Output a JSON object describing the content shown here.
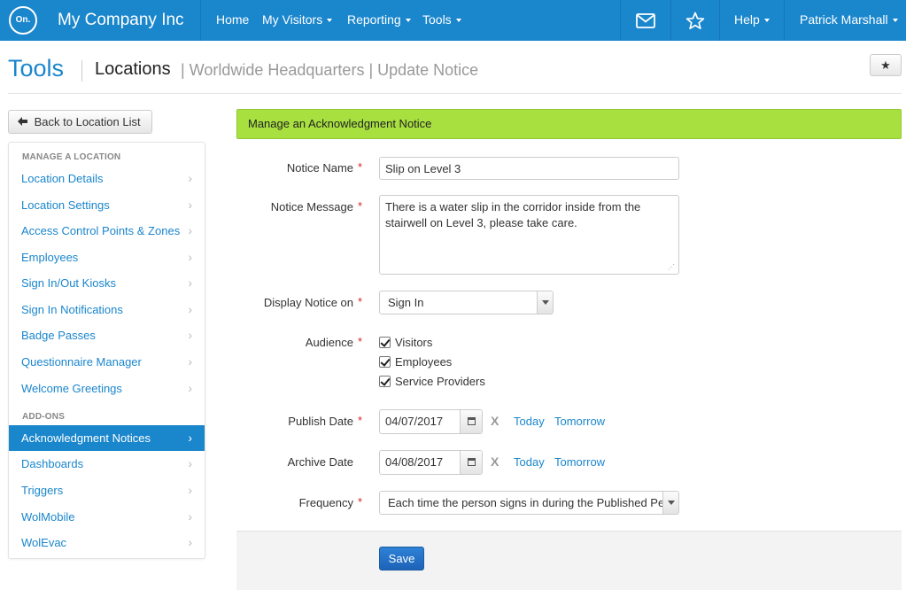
{
  "navbar": {
    "logo_text": "On.",
    "brand": "My Company Inc",
    "menu": [
      {
        "label": "Home",
        "dropdown": false
      },
      {
        "label": "My Visitors",
        "dropdown": true
      },
      {
        "label": "Reporting",
        "dropdown": true
      },
      {
        "label": "Tools",
        "dropdown": true
      }
    ],
    "mail_icon": "envelope-icon",
    "favorite_icon": "star-outline-icon",
    "help_label": "Help",
    "user_name": "Patrick Marshall"
  },
  "header": {
    "title": "Tools",
    "crumb_main": "Locations",
    "crumb_rest": "| Worldwide Headquarters | Update Notice",
    "star_glyph": "★"
  },
  "back_button": {
    "icon": "arrow-left-icon",
    "label": "Back to Location List"
  },
  "sidebar": {
    "section_manage": "MANAGE A LOCATION",
    "manage_items": [
      "Location Details",
      "Location Settings",
      "Access Control Points & Zones",
      "Employees",
      "Sign In/Out Kiosks",
      "Sign In Notifications",
      "Badge Passes",
      "Questionnaire Manager",
      "Welcome Greetings"
    ],
    "section_addons": "ADD-ONS",
    "addon_items": [
      "Acknowledgment Notices",
      "Dashboards",
      "Triggers",
      "WolMobile",
      "WolEvac"
    ],
    "active_item": "Acknowledgment Notices"
  },
  "panel": {
    "heading": "Manage an Acknowledgment Notice"
  },
  "form": {
    "required_marker": "*",
    "notice_name": {
      "label": "Notice Name",
      "value": "Slip on Level 3"
    },
    "notice_message": {
      "label": "Notice Message",
      "value": "There is a water slip in the corridor inside from the stairwell on Level 3, please take care."
    },
    "display_on": {
      "label": "Display Notice on",
      "value": "Sign In"
    },
    "audience": {
      "label": "Audience",
      "options": [
        {
          "label": "Visitors",
          "checked": true
        },
        {
          "label": "Employees",
          "checked": true
        },
        {
          "label": "Service Providers",
          "checked": true
        }
      ]
    },
    "publish_date": {
      "label": "Publish Date",
      "value": "04/07/2017"
    },
    "archive_date": {
      "label": "Archive Date",
      "value": "04/08/2017"
    },
    "clear_label": "X",
    "today_label": "Today",
    "tomorrow_label": "Tomorrow",
    "frequency": {
      "label": "Frequency",
      "value": "Each time the person signs in during the Published Period"
    },
    "save_label": "Save"
  },
  "colors": {
    "navbar": "#1a86cc",
    "link": "#1a86cc",
    "panel_heading": "#a8e040",
    "required": "#d9262a",
    "save_button": "#1d6fc4"
  }
}
